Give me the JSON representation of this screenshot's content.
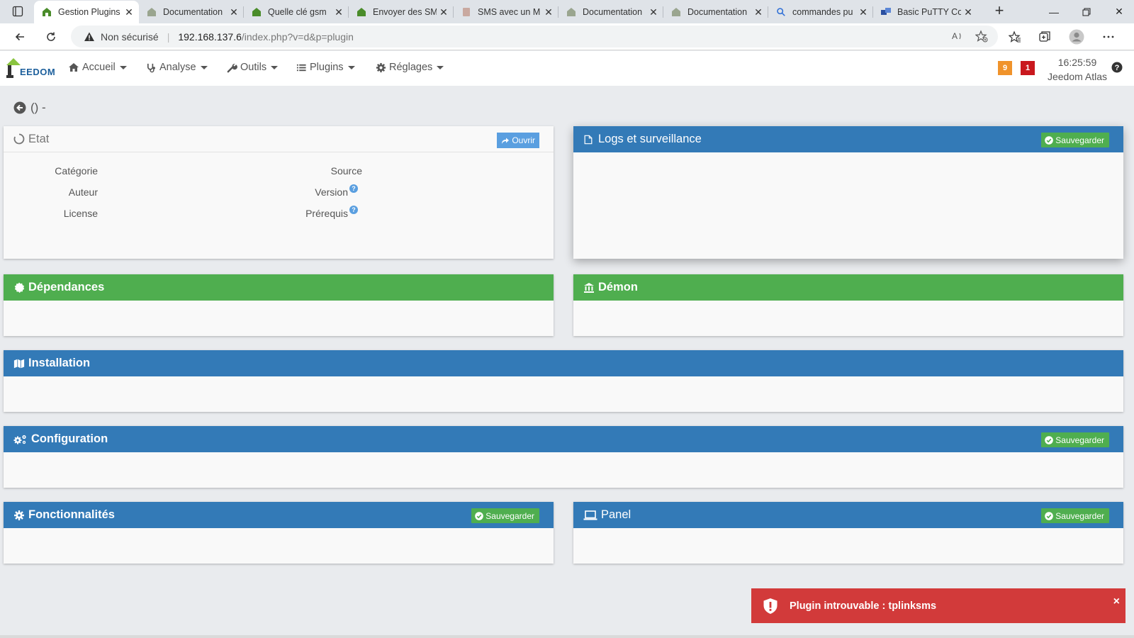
{
  "browser": {
    "tabs": [
      {
        "title": "Gestion Plugins",
        "active": true
      },
      {
        "title": "Documentation",
        "active": false
      },
      {
        "title": "Quelle clé gsm",
        "active": false
      },
      {
        "title": "Envoyer des SMS",
        "active": false
      },
      {
        "title": "SMS avec un M",
        "active": false
      },
      {
        "title": "Documentation",
        "active": false
      },
      {
        "title": "Documentation",
        "active": false
      },
      {
        "title": "commandes pu",
        "active": false
      },
      {
        "title": "Basic PuTTY Co",
        "active": false
      }
    ],
    "address": {
      "security": "Non sécurisé",
      "host": "192.168.137.6",
      "path": "/index.php?v=d&p=plugin"
    }
  },
  "navbar": {
    "logo_text": "EEDOM",
    "menus": [
      "Accueil",
      "Analyse",
      "Outils",
      "Plugins",
      "Réglages"
    ],
    "badge_orange": "9",
    "badge_red": "1",
    "time": "16:25:59",
    "instance": "Jeedom Atlas"
  },
  "page": {
    "title": "() -"
  },
  "panels": {
    "etat": {
      "title": "Etat",
      "open_button": "Ouvrir",
      "labels": {
        "categorie": "Catégorie",
        "auteur": "Auteur",
        "license": "License",
        "source": "Source",
        "version": "Version",
        "prerequis": "Prérequis"
      }
    },
    "logs": {
      "title": "Logs et surveillance",
      "save": "Sauvegarder"
    },
    "dependances": {
      "title": "Dépendances"
    },
    "demon": {
      "title": "Démon"
    },
    "installation": {
      "title": "Installation"
    },
    "configuration": {
      "title": "Configuration",
      "save": "Sauvegarder"
    },
    "fonctionnalites": {
      "title": "Fonctionnalités",
      "save": "Sauvegarder"
    },
    "panel": {
      "title": "Panel",
      "save": "Sauvegarder"
    }
  },
  "toast": {
    "message": "Plugin introuvable : tplinksms",
    "close": "×"
  },
  "colors": {
    "blue_header": "#337ab7",
    "green_header": "#4fae4f",
    "toast_red": "#d23a3a",
    "badge_orange": "#f0932b",
    "badge_red": "#c9181e"
  }
}
